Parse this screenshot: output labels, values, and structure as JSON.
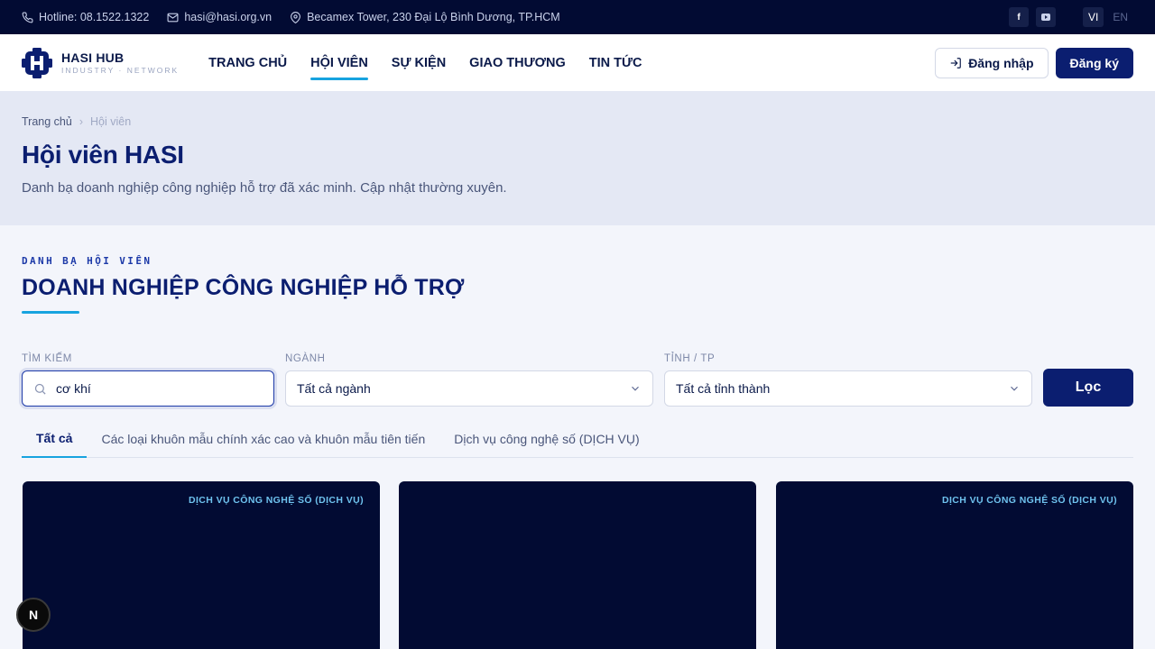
{
  "topbar": {
    "hotline": "Hotline: 08.1522.1322",
    "email": "hasi@hasi.org.vn",
    "address": "Becamex Tower, 230 Đại Lộ Bình Dương, TP.HCM",
    "social": [
      "facebook-icon",
      "youtube-icon"
    ],
    "lang_vi": "VI",
    "lang_en": "EN"
  },
  "header": {
    "brand": "HASI HUB",
    "tagline": "INDUSTRY · NETWORK",
    "nav": [
      "TRANG CHỦ",
      "HỘI VIÊN",
      "SỰ KIỆN",
      "GIAO THƯƠNG",
      "TIN TỨC"
    ],
    "active_nav": "HỘI VIÊN",
    "login": "Đăng nhập",
    "signup": "Đăng ký"
  },
  "hero": {
    "breadcrumb": [
      "Trang chủ",
      "Hội viên"
    ],
    "title": "Hội viên HASI",
    "subtitle": "Danh bạ doanh nghiệp công nghiệp hỗ trợ đã xác minh. Cập nhật thường xuyên."
  },
  "section": {
    "eyebrow": "DANH BẠ HỘI VIÊN",
    "title": "DOANH NGHIỆP CÔNG NGHIỆP HỖ TRỢ"
  },
  "filters": {
    "search_label": "TÌM KIẾM",
    "search_value": "cơ khí",
    "industry_label": "NGÀNH",
    "industry_value": "Tất cả ngành",
    "province_label": "TỈNH / TP",
    "province_value": "Tất cả tỉnh thành",
    "submit": "Lọc"
  },
  "tabs": [
    "Tất cả",
    "Các loại khuôn mẫu chính xác cao và khuôn mẫu tiên tiến",
    "Dịch vụ công nghệ số (DỊCH VỤ)"
  ],
  "cards": [
    {
      "tag": "DỊCH VỤ CÔNG NGHỆ SỐ (DỊCH VỤ)"
    },
    {
      "tag": ""
    },
    {
      "tag": "DỊCH VỤ CÔNG NGHỆ SỐ (DỊCH VỤ)"
    }
  ],
  "fab": "N",
  "colors": {
    "navy": "#020b33",
    "primary": "#0b1e70",
    "accent": "#17a3df"
  }
}
